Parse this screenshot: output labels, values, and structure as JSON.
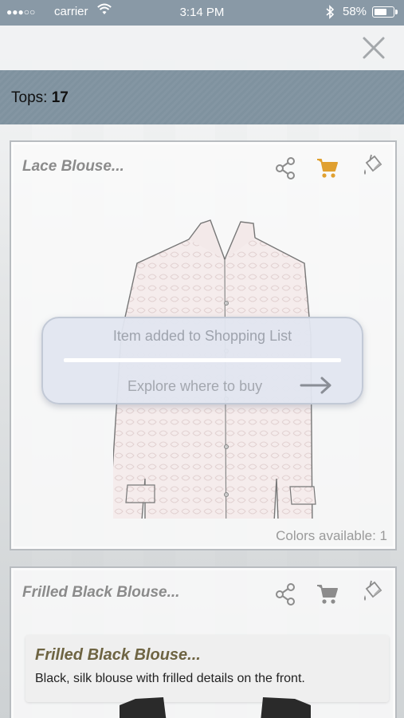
{
  "status_bar": {
    "signal": "●●●○○",
    "carrier": "carrier",
    "time": "3:14 PM",
    "battery_pct": "58%",
    "battery_level": 0.58,
    "icons": [
      "wifi-icon",
      "bluetooth-icon",
      "battery-icon"
    ]
  },
  "header": {
    "close_icon": "close-icon"
  },
  "category": {
    "label": "Tops: ",
    "count": "17"
  },
  "items": [
    {
      "title": "Lace Blouse...",
      "colors_available": "Colors available: 1",
      "icons": [
        "share-icon",
        "cart-icon",
        "paint-bucket-icon"
      ],
      "in_cart": true
    },
    {
      "title": "Frilled Black Blouse...",
      "icons": [
        "share-icon",
        "cart-icon",
        "paint-bucket-icon"
      ],
      "in_cart": false,
      "detail": {
        "title": "Frilled Black Blouse...",
        "description": "Black, silk blouse with frilled details on the front."
      }
    }
  ],
  "toast": {
    "message": "Item added to Shopping List",
    "action": "Explore where to buy",
    "action_icon": "arrow-right-icon"
  },
  "colors": {
    "status_bar": "#8999a6",
    "category_bar": "#8496a3",
    "cart_active": "#e0a030",
    "icon_gray": "#8c8c8c"
  }
}
